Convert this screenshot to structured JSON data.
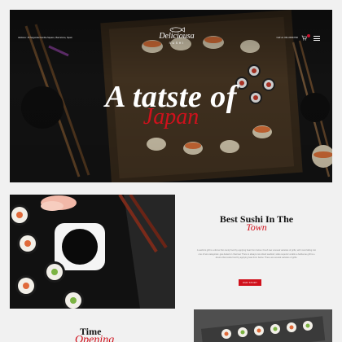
{
  "header": {
    "address": "Address: 15 Segunda Familia Square, Barcelona, Spain",
    "call": "Call Us: 001-00043700",
    "logo_name": "Deliciousa",
    "logo_sub": "SUSHI",
    "cart_count": ""
  },
  "hero": {
    "title": "A tatste of",
    "script": "Japan"
  },
  "story": {
    "title": "Best Sushi In The",
    "script": "Town",
    "text": "A sashimi grill is a divine first candy food by applying heat from below. Fresh raw unusual varieties of grills, with most falling into one of two categories: gas-fueled or charcoal. There is always raw sliced seafood, sides superior a table a barbecue grill is a device that cooks food by applying heat from below. There are several varieties of grills.",
    "button": "OUR STORY"
  },
  "hours": {
    "title": "Time",
    "script": "Opening"
  },
  "colors": {
    "accent": "#d0111c",
    "dark": "#141414",
    "background": "#f1f1f1"
  }
}
